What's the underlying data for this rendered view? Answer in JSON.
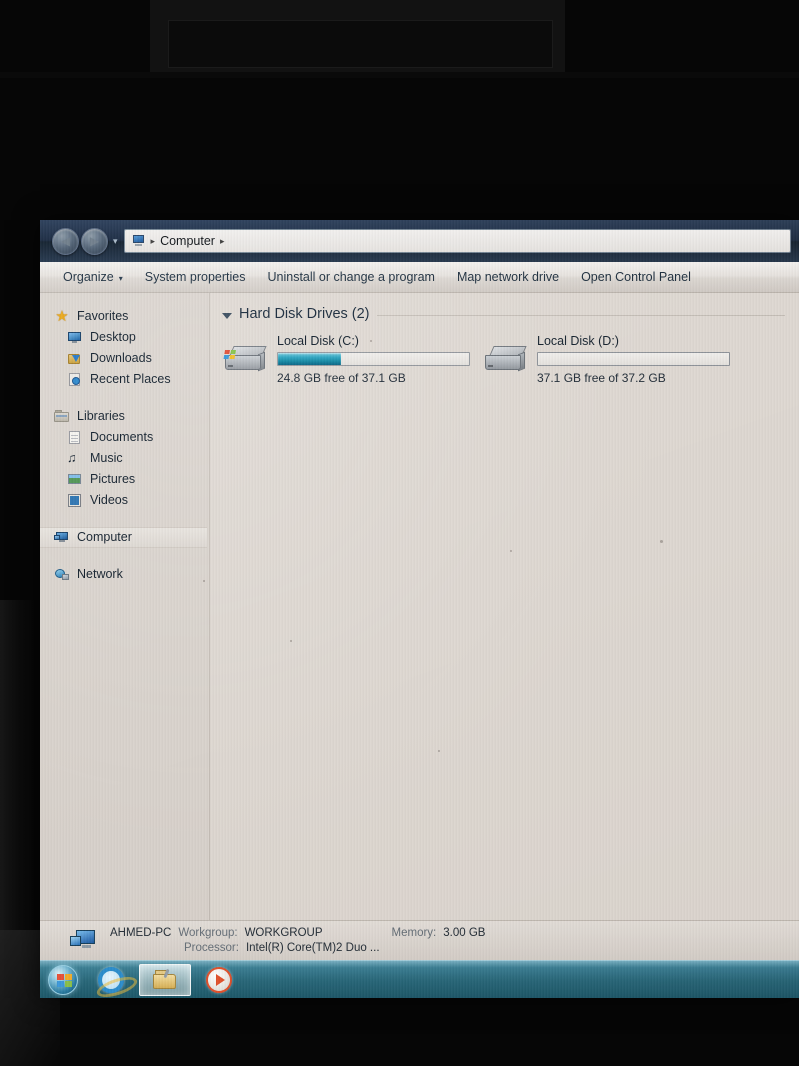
{
  "window": {
    "breadcrumb_icon": "computer-icon",
    "breadcrumb_root": "Computer",
    "back_glyph": "◀",
    "forward_glyph": "▶",
    "history_caret": "▾",
    "crumb_sep": "▸"
  },
  "toolbar": {
    "organize": "Organize",
    "organize_caret": "▾",
    "system_properties": "System properties",
    "uninstall": "Uninstall or change a program",
    "map_drive": "Map network drive",
    "control_panel": "Open Control Panel"
  },
  "navpane": {
    "groups": [
      {
        "header": "Favorites",
        "header_icon": "star-icon",
        "items": [
          {
            "label": "Desktop",
            "icon": "desktop-icon"
          },
          {
            "label": "Downloads",
            "icon": "downloads-icon"
          },
          {
            "label": "Recent Places",
            "icon": "recent-places-icon"
          }
        ]
      },
      {
        "header": "Libraries",
        "header_icon": "libraries-icon",
        "items": [
          {
            "label": "Documents",
            "icon": "documents-icon"
          },
          {
            "label": "Music",
            "icon": "music-icon"
          },
          {
            "label": "Pictures",
            "icon": "pictures-icon"
          },
          {
            "label": "Videos",
            "icon": "videos-icon"
          }
        ]
      },
      {
        "header": "Computer",
        "header_icon": "computer-icon",
        "selected": true,
        "items": []
      },
      {
        "header": "Network",
        "header_icon": "network-icon",
        "items": []
      }
    ]
  },
  "content": {
    "group_title": "Hard Disk Drives (2)",
    "drives": [
      {
        "name": "Local Disk (C:)",
        "free_text": "24.8 GB free of 37.1 GB",
        "free_gb": 24.8,
        "total_gb": 37.1,
        "used_percent": 33,
        "icon": "hard-drive-system-icon",
        "bar_color": "#1c85a3"
      },
      {
        "name": "Local Disk (D:)",
        "free_text": "37.1 GB free of 37.2 GB",
        "free_gb": 37.1,
        "total_gb": 37.2,
        "used_percent": 0,
        "icon": "hard-drive-icon",
        "bar_color": "#1c85a3"
      }
    ]
  },
  "statusbar": {
    "computer_name": "AHMED-PC",
    "workgroup_key": "Workgroup:",
    "workgroup_value": "WORKGROUP",
    "memory_key": "Memory:",
    "memory_value": "3.00 GB",
    "processor_key": "Processor:",
    "processor_value": "Intel(R) Core(TM)2 Duo ..."
  },
  "taskbar": {
    "start_label": "Start",
    "buttons": [
      {
        "name": "internet-explorer",
        "icon": "internet-explorer-icon",
        "active": false
      },
      {
        "name": "windows-explorer",
        "icon": "folder-icon",
        "active": true
      },
      {
        "name": "windows-media-player",
        "icon": "media-player-icon",
        "active": false
      }
    ]
  },
  "colors": {
    "accent": "#1c85a3",
    "window_chrome": "#ddd7d1",
    "taskbar": "#2a6d80",
    "titlebar": "#1d2b40"
  }
}
